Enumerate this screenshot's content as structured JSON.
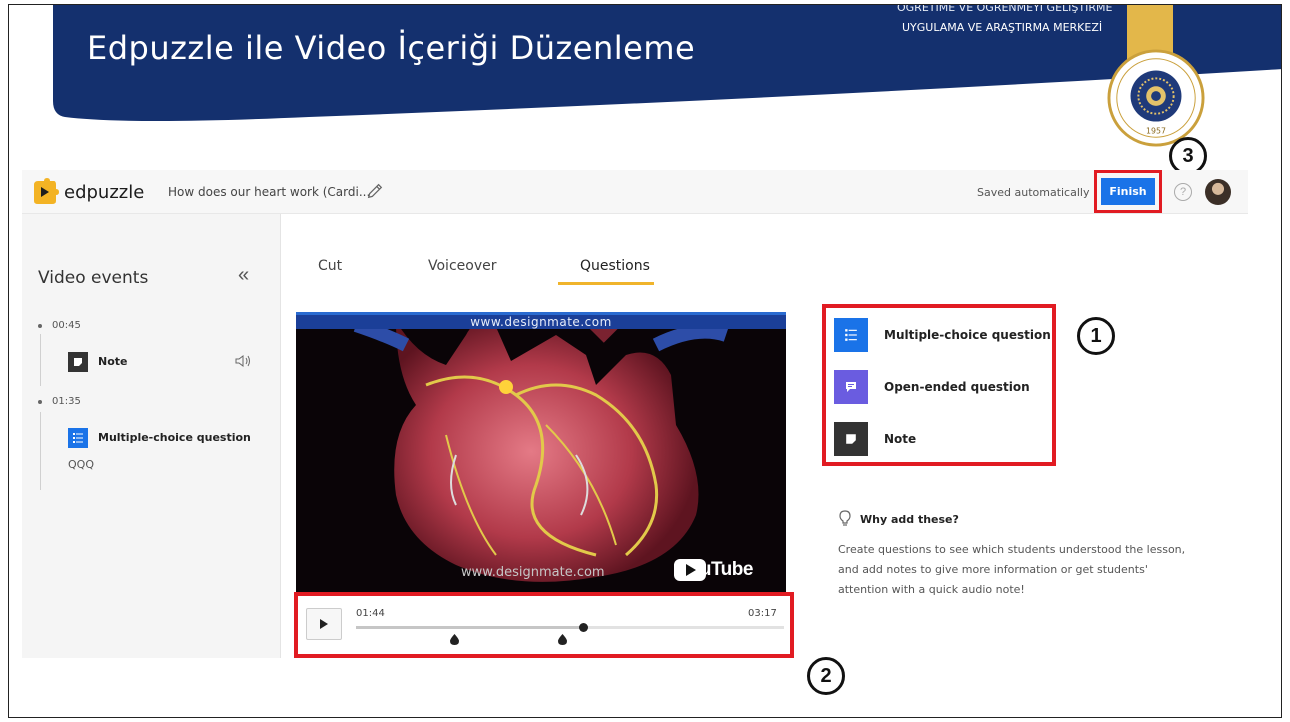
{
  "slide": {
    "title": "Edpuzzle ile Video İçeriği Düzenleme",
    "institution_line1": "ÖĞRETİME VE ÖĞRENMEYİ GELİŞTİRME",
    "institution_line2": "UYGULAMA VE ARAŞTIRMA MERKEZİ",
    "seal_year": "1957",
    "seal_text": "ATATÜRK ÜNİVERSİTESİ",
    "banner_color": "#14306e",
    "accent_red": "#e11b22",
    "callouts": [
      "1",
      "2",
      "3"
    ]
  },
  "header": {
    "logo_text": "edpuzzle",
    "video_title": "How does our heart work (Cardi...",
    "saved_status": "Saved automatically",
    "finish_label": "Finish",
    "help_label": "?",
    "brand_blue": "#1a73e8"
  },
  "sidebar": {
    "title": "Video events",
    "collapse_glyph": "«",
    "events": [
      {
        "time": "00:45",
        "type": "Note",
        "label": "Note",
        "sub": "",
        "icon": "note-icon"
      },
      {
        "time": "01:35",
        "type": "Multiple-choice question",
        "label": "Multiple-choice question",
        "sub": "QQQ",
        "icon": "multiple-choice-icon"
      }
    ]
  },
  "tabs": [
    {
      "label": "Cut",
      "active": false
    },
    {
      "label": "Voiceover",
      "active": false
    },
    {
      "label": "Questions",
      "active": true
    }
  ],
  "video": {
    "watermark_top": "www.designmate.com",
    "watermark_bottom": "www.designmate.com",
    "youtube_label": "YouTube"
  },
  "player": {
    "current_time": "01:44",
    "total_time": "03:17",
    "progress_fraction": 0.53,
    "event_markers": [
      "00:45",
      "01:35"
    ]
  },
  "question_types": [
    {
      "label": "Multiple-choice question",
      "icon": "multiple-choice-icon",
      "color": "#1a73e8"
    },
    {
      "label": "Open-ended question",
      "icon": "open-ended-icon",
      "color": "#6a5ce0"
    },
    {
      "label": "Note",
      "icon": "note-icon",
      "color": "#333333"
    }
  ],
  "why": {
    "title": "Why add these?",
    "text": "Create questions to see which students understood the lesson, and add notes to give more information or get students' attention with a quick audio note!"
  }
}
